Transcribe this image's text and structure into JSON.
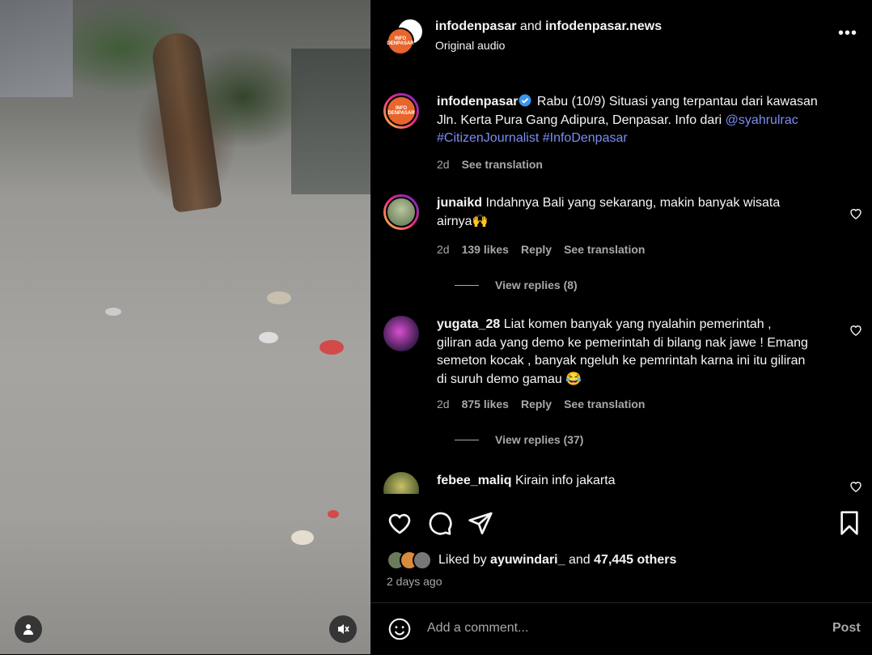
{
  "header": {
    "user1": "infodenpasar",
    "conj": "and",
    "user2": "infodenpasar.news",
    "audio": "Original audio",
    "more_icon": "more-horizontal-icon"
  },
  "avatar_text": {
    "line1": "INFO",
    "line2": "DENPASAR"
  },
  "caption": {
    "username": "infodenpasar",
    "text": "Rabu (10/9) Situasi yang terpantau dari kawasan Jln. Kerta Pura Gang Adipura, Denpasar. Info dari",
    "mention": "@syahrulrac",
    "hashtags": "#CitizenJournalist #InfoDenpasar",
    "time": "2d",
    "translate": "See translation"
  },
  "comments": [
    {
      "username": "junaikd",
      "text": "Indahnya Bali yang sekarang, makin banyak wisata airnya🙌",
      "time": "2d",
      "likes": "139 likes",
      "reply": "Reply",
      "translate": "See translation",
      "view_replies": "View replies (8)"
    },
    {
      "username": "yugata_28",
      "text": "Liat komen banyak yang nyalahin pemerintah , giliran ada yang demo ke pemerintah di bilang nak jawe ! Emang semeton kocak , banyak ngeluh ke pemrintah karna ini itu giliran di suruh demo gamau 😂",
      "time": "2d",
      "likes": "875 likes",
      "reply": "Reply",
      "translate": "See translation",
      "view_replies": "View replies (37)"
    },
    {
      "username": "febee_maliq",
      "text": "Kirain info jakarta"
    }
  ],
  "likes": {
    "prefix": "Liked by",
    "user": "ayuwindari_",
    "conj": "and",
    "others": "47,445 others"
  },
  "date": "2 days ago",
  "add_comment": {
    "placeholder": "Add a comment...",
    "post": "Post"
  },
  "colors": {
    "link": "#7c8df5",
    "muted": "#a8a8a8",
    "brand": "#e8652b"
  }
}
